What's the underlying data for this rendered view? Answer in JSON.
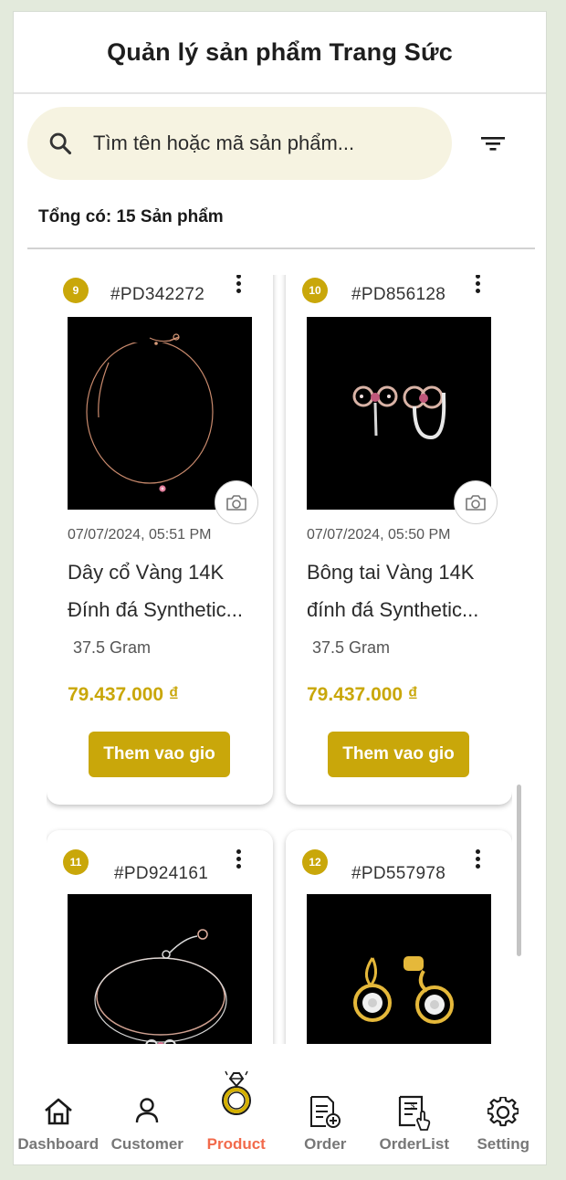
{
  "header": {
    "title": "Quản lý sản phẩm Trang Sức"
  },
  "search": {
    "placeholder": "Tìm tên hoặc mã sản phẩm..."
  },
  "summary": {
    "total_text": "Tổng có: 15 Sản phẩm"
  },
  "products": [
    {
      "index": "9",
      "code": "#PD342272",
      "date": "07/07/2024, 05:51 PM",
      "name_line1": "Dây cổ Vàng 14K",
      "name_line2": "Đính đá Synthetic...",
      "weight": "37.5 Gram",
      "price": "79.437.000 ₫",
      "button": "Them vao gio",
      "image": "necklace"
    },
    {
      "index": "10",
      "code": "#PD856128",
      "date": "07/07/2024, 05:50 PM",
      "name_line1": "Bông tai Vàng 14K",
      "name_line2": "đính đá Synthetic...",
      "weight": "37.5 Gram",
      "price": "79.437.000 ₫",
      "button": "Them vao gio",
      "image": "earrings-flower"
    },
    {
      "index": "11",
      "code": "#PD924161",
      "image": "bracelet"
    },
    {
      "index": "12",
      "code": "#PD557978",
      "image": "earrings-gold"
    }
  ],
  "nav": [
    {
      "label": "Dashboard",
      "icon": "home-icon",
      "active": false
    },
    {
      "label": "Customer",
      "icon": "user-icon",
      "active": false
    },
    {
      "label": "Product",
      "icon": "ring-icon",
      "active": true
    },
    {
      "label": "Order",
      "icon": "order-icon",
      "active": false
    },
    {
      "label": "OrderList",
      "icon": "orderlist-icon",
      "active": false
    },
    {
      "label": "Setting",
      "icon": "gear-icon",
      "active": false
    }
  ],
  "colors": {
    "accent": "#c9a70a",
    "active_nav": "#f26a4b",
    "background": "#e3eadc"
  }
}
